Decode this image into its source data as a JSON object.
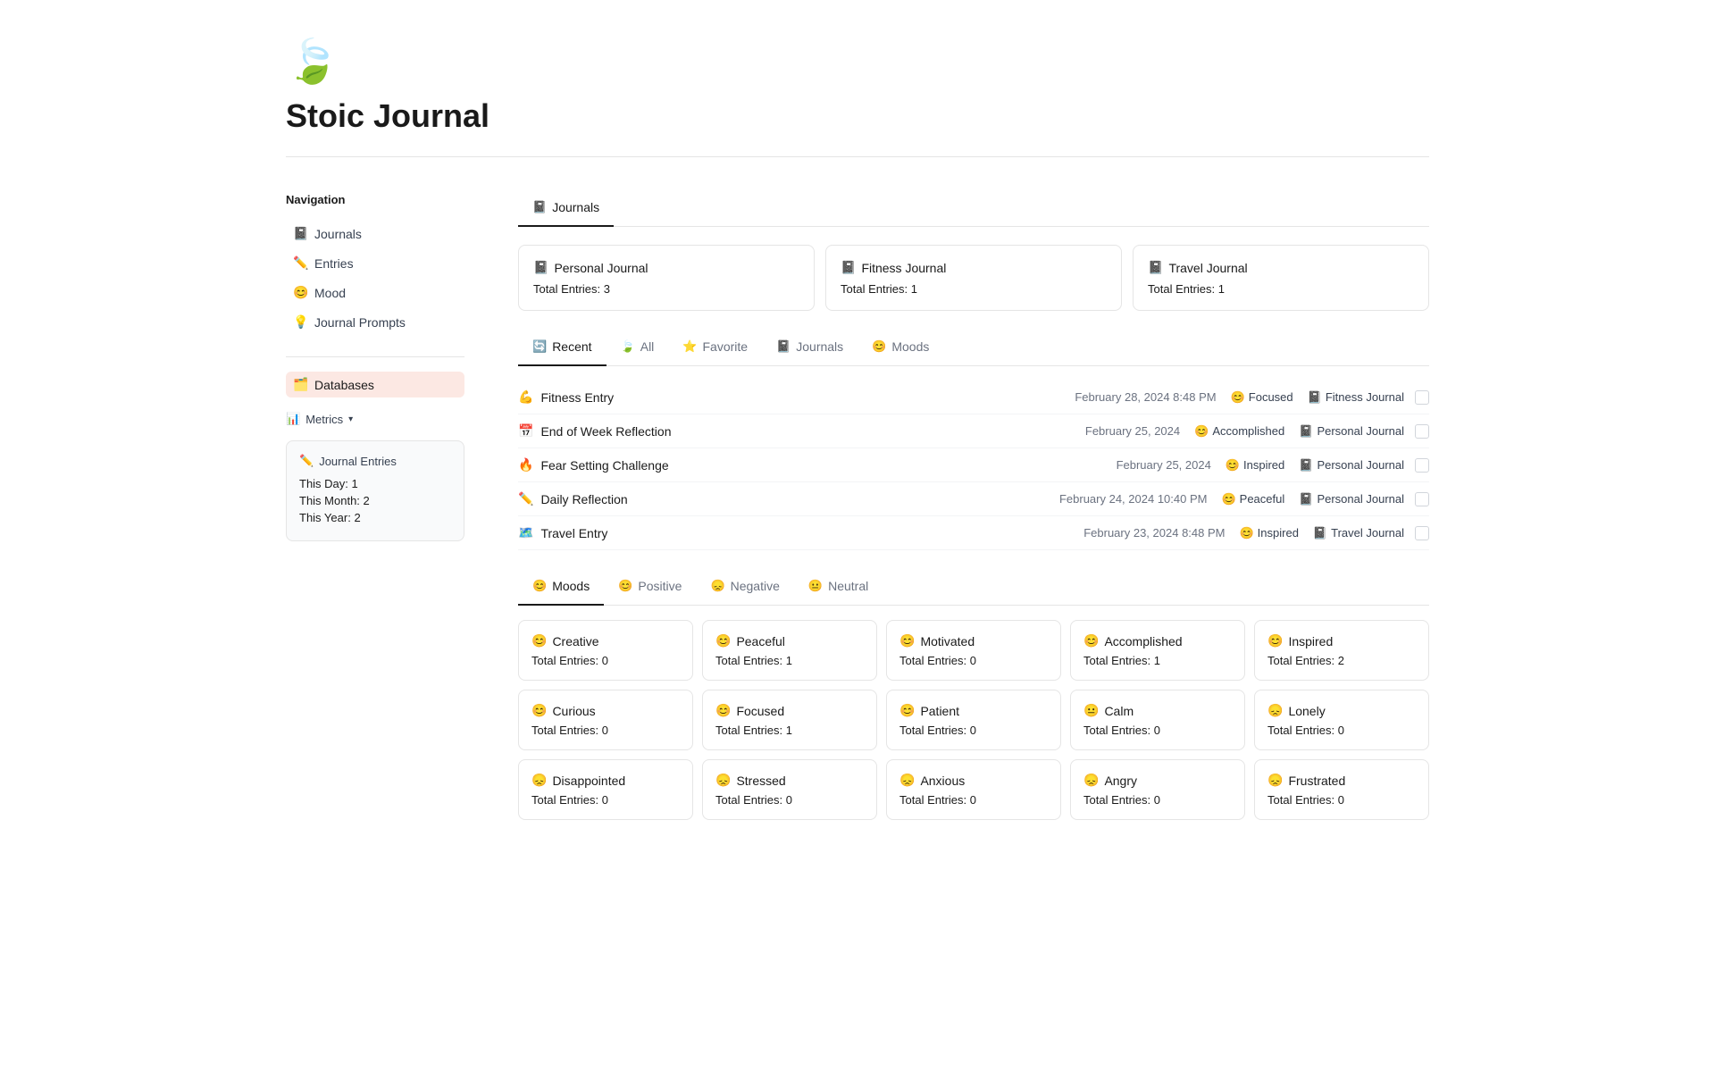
{
  "header": {
    "logo_icon": "🍃",
    "title": "Stoic Journal",
    "divider": true
  },
  "sidebar": {
    "heading": "Navigation",
    "nav_items": [
      {
        "label": "Journals",
        "icon": "📓",
        "id": "journals",
        "active": false
      },
      {
        "label": "Entries",
        "icon": "✏️",
        "id": "entries",
        "active": false
      },
      {
        "label": "Mood",
        "icon": "😊",
        "id": "mood",
        "active": false
      },
      {
        "label": "Journal Prompts",
        "icon": "💡",
        "id": "journal-prompts",
        "active": false
      },
      {
        "label": "Databases",
        "icon": "🗂️",
        "id": "databases",
        "active": true
      }
    ],
    "metrics_label": "Metrics",
    "metrics_card": {
      "title": "Journal Entries",
      "icon": "✏️",
      "stats": [
        {
          "label": "This Day:",
          "value": "1"
        },
        {
          "label": "This Month:",
          "value": "2"
        },
        {
          "label": "This Year:",
          "value": "2"
        }
      ]
    }
  },
  "content": {
    "main_tabs": [
      {
        "label": "Journals",
        "icon": "📓",
        "active": true
      }
    ],
    "journals_section_title": "Journals",
    "journal_cards": [
      {
        "title": "Personal Journal",
        "icon": "📓",
        "entries_label": "Total Entries:",
        "entries_value": "3"
      },
      {
        "title": "Fitness Journal",
        "icon": "📓",
        "entries_label": "Total Entries:",
        "entries_value": "1"
      },
      {
        "title": "Travel Journal",
        "icon": "📓",
        "entries_label": "Total Entries:",
        "entries_value": "1"
      }
    ],
    "sub_tabs": [
      {
        "label": "Recent",
        "icon": "🔄",
        "active": true
      },
      {
        "label": "All",
        "icon": "🍃",
        "active": false
      },
      {
        "label": "Favorite",
        "icon": "⭐",
        "active": false
      },
      {
        "label": "Journals",
        "icon": "📓",
        "active": false
      },
      {
        "label": "Moods",
        "icon": "😊",
        "active": false
      }
    ],
    "entries": [
      {
        "icon": "💪",
        "name": "Fitness Entry",
        "date": "February 28, 2024 8:48 PM",
        "mood": "Focused",
        "mood_icon": "😊",
        "journal": "Fitness Journal",
        "journal_icon": "📓"
      },
      {
        "icon": "📅",
        "name": "End of Week Reflection",
        "date": "February 25, 2024",
        "mood": "Accomplished",
        "mood_icon": "😊",
        "journal": "Personal Journal",
        "journal_icon": "📓"
      },
      {
        "icon": "🔥",
        "name": "Fear Setting Challenge",
        "date": "February 25, 2024",
        "mood": "Inspired",
        "mood_icon": "😊",
        "journal": "Personal Journal",
        "journal_icon": "📓"
      },
      {
        "icon": "✏️",
        "name": "Daily Reflection",
        "date": "February 24, 2024 10:40 PM",
        "mood": "Peaceful",
        "mood_icon": "😊",
        "journal": "Personal Journal",
        "journal_icon": "📓"
      },
      {
        "icon": "🗺️",
        "name": "Travel Entry",
        "date": "February 23, 2024 8:48 PM",
        "mood": "Inspired",
        "mood_icon": "😊",
        "journal": "Travel Journal",
        "journal_icon": "📓"
      }
    ],
    "moods_section": {
      "tabs": [
        {
          "label": "Moods",
          "icon": "😊",
          "active": true
        },
        {
          "label": "Positive",
          "icon": "😊",
          "active": false
        },
        {
          "label": "Negative",
          "icon": "😞",
          "active": false
        },
        {
          "label": "Neutral",
          "icon": "😐",
          "active": false
        }
      ],
      "mood_cards": [
        {
          "title": "Creative",
          "icon": "😊",
          "entries_label": "Total Entries:",
          "entries_value": "0"
        },
        {
          "title": "Peaceful",
          "icon": "😊",
          "entries_label": "Total Entries:",
          "entries_value": "1"
        },
        {
          "title": "Motivated",
          "icon": "😊",
          "entries_label": "Total Entries:",
          "entries_value": "0"
        },
        {
          "title": "Accomplished",
          "icon": "😊",
          "entries_label": "Total Entries:",
          "entries_value": "1"
        },
        {
          "title": "Inspired",
          "icon": "😊",
          "entries_label": "Total Entries:",
          "entries_value": "2"
        },
        {
          "title": "Curious",
          "icon": "😊",
          "entries_label": "Total Entries:",
          "entries_value": "0"
        },
        {
          "title": "Focused",
          "icon": "😊",
          "entries_label": "Total Entries:",
          "entries_value": "1"
        },
        {
          "title": "Patient",
          "icon": "😊",
          "entries_label": "Total Entries:",
          "entries_value": "0"
        },
        {
          "title": "Calm",
          "icon": "😐",
          "entries_label": "Total Entries:",
          "entries_value": "0"
        },
        {
          "title": "Lonely",
          "icon": "😞",
          "entries_label": "Total Entries:",
          "entries_value": "0"
        },
        {
          "title": "Disappointed",
          "icon": "😞",
          "entries_label": "Total Entries:",
          "entries_value": "0"
        },
        {
          "title": "Stressed",
          "icon": "😞",
          "entries_label": "Total Entries:",
          "entries_value": "0"
        },
        {
          "title": "Anxious",
          "icon": "😞",
          "entries_label": "Total Entries:",
          "entries_value": "0"
        },
        {
          "title": "Angry",
          "icon": "😞",
          "entries_label": "Total Entries:",
          "entries_value": "0"
        },
        {
          "title": "Frustrated",
          "icon": "😞",
          "entries_label": "Total Entries:",
          "entries_value": "0"
        }
      ]
    }
  }
}
